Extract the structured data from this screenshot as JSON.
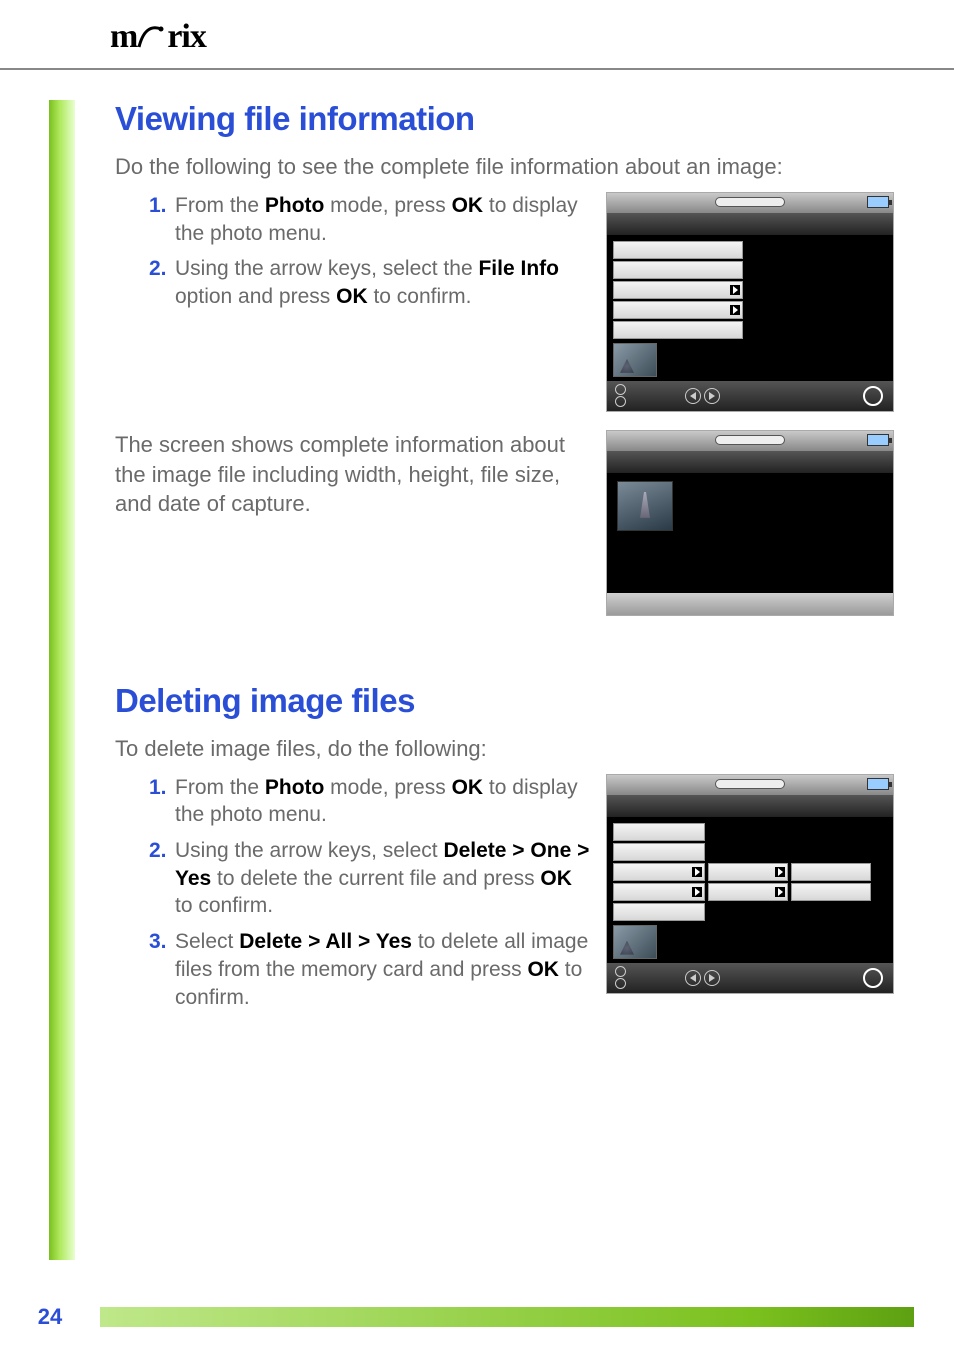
{
  "logo_text": "m rix",
  "section1": {
    "heading": "Viewing file information",
    "intro": "Do the following to see the complete file information about an image:",
    "steps": [
      {
        "num": "1.",
        "pre": "From the ",
        "b1": "Photo",
        "mid1": " mode, press ",
        "b2": "OK",
        "post": " to display the photo menu."
      },
      {
        "num": "2.",
        "pre": "Using the arrow keys, select the ",
        "b1": "File Info",
        "mid1": " option and press ",
        "b2": "OK",
        "post": " to confirm."
      }
    ],
    "desc": "The screen shows complete information about the image file including width, height, file size, and date of capture."
  },
  "section2": {
    "heading": "Deleting image files",
    "intro": "To delete image files, do the following:",
    "steps": [
      {
        "num": "1.",
        "pre": "From the ",
        "b1": "Photo",
        "mid1": " mode, press ",
        "b2": "OK",
        "post": " to display the photo menu."
      },
      {
        "num": "2.",
        "pre": "Using the arrow keys, select ",
        "b1": "Delete > One > Yes",
        "mid1": " to delete the current file and press ",
        "b2": "OK",
        "post": " to confirm."
      },
      {
        "num": "3.",
        "pre": "Select ",
        "b1": "Delete > All > Yes",
        "mid1": " to delete all image files from the memory card and press ",
        "b2": "OK",
        "post": " to confirm."
      }
    ]
  },
  "page_number": "24"
}
